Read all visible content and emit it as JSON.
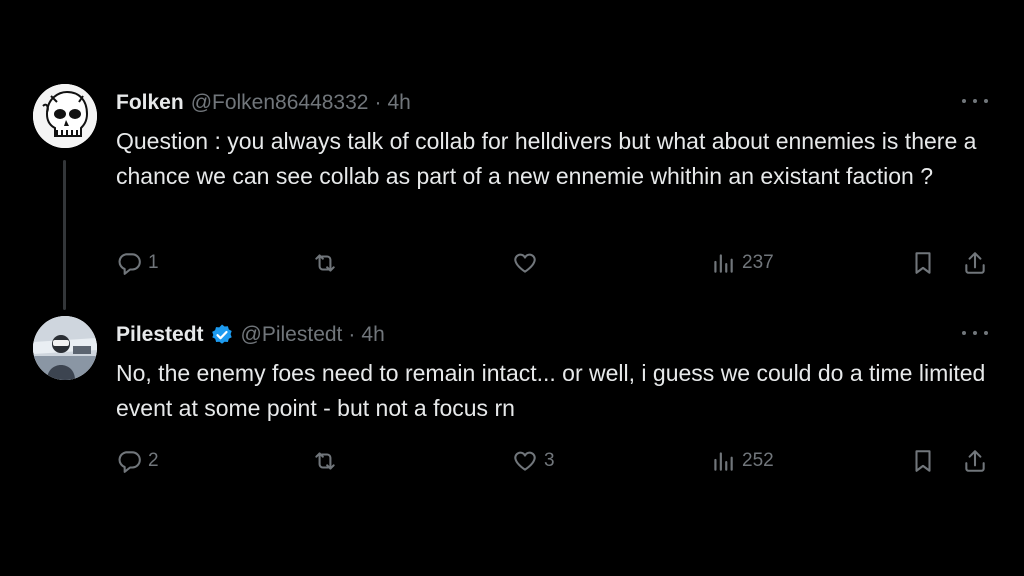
{
  "tweets": [
    {
      "display_name": "Folken",
      "handle": "@Folken86448332",
      "separator": "·",
      "time": "4h",
      "text": "Question : you always talk of collab for helldivers but what about ennemies is there a chance we can see collab as part of a new ennemie whithin an existant faction ?",
      "reply_count": "1",
      "retweet_count": "",
      "like_count": "",
      "view_count": "237",
      "verified": false
    },
    {
      "display_name": "Pilestedt",
      "handle": "@Pilestedt",
      "separator": "·",
      "time": "4h",
      "text": "No, the enemy foes need to remain intact... or well, i guess we could do a time limited event at some point - but not a focus rn",
      "reply_count": "2",
      "retweet_count": "",
      "like_count": "3",
      "view_count": "252",
      "verified": true
    }
  ],
  "colors": {
    "background": "#000000",
    "text": "#e7e9ea",
    "muted": "#71767b",
    "verified": "#1d9bf0",
    "thread_line": "#333639"
  },
  "icons": {
    "reply": "reply-icon",
    "retweet": "retweet-icon",
    "like": "heart-icon",
    "views": "views-icon",
    "bookmark": "bookmark-icon",
    "share": "share-icon",
    "more": "more-icon",
    "verified": "verified-badge-icon"
  }
}
